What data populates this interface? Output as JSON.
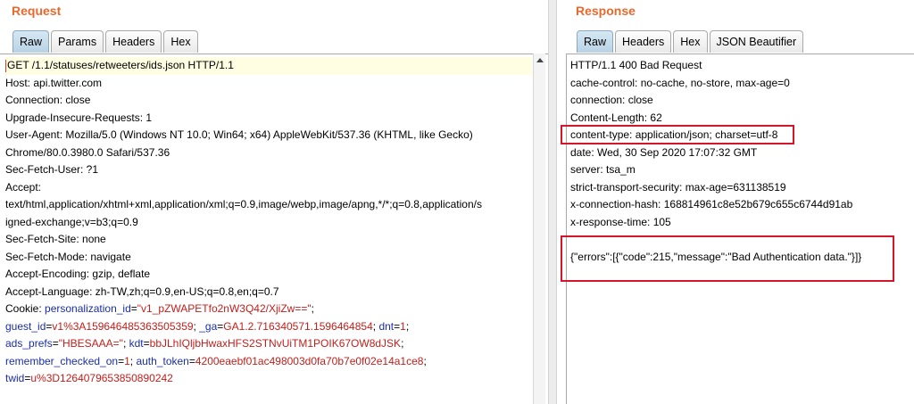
{
  "request": {
    "title": "Request",
    "tabs": [
      "Raw",
      "Params",
      "Headers",
      "Hex"
    ],
    "active_tab": 0,
    "lines": [
      [
        {
          "t": "GET /1.1/statuses/retweeters/ids.json HTTP/1.1"
        }
      ],
      [
        {
          "t": "Host: api.twitter.com"
        }
      ],
      [
        {
          "t": "Connection: close"
        }
      ],
      [
        {
          "t": "Upgrade-Insecure-Requests: 1"
        }
      ],
      [
        {
          "t": "User-Agent: Mozilla/5.0 (Windows NT 10.0; Win64; x64) AppleWebKit/537.36 (KHTML, like Gecko)"
        }
      ],
      [
        {
          "t": "Chrome/80.0.3980.0 Safari/537.36"
        }
      ],
      [
        {
          "t": "Sec-Fetch-User: ?1"
        }
      ],
      [
        {
          "t": "Accept:"
        }
      ],
      [
        {
          "t": "text/html,application/xhtml+xml,application/xml;q=0.9,image/webp,image/apng,*/*;q=0.8,application/s"
        }
      ],
      [
        {
          "t": "igned-exchange;v=b3;q=0.9"
        }
      ],
      [
        {
          "t": "Sec-Fetch-Site: none"
        }
      ],
      [
        {
          "t": "Sec-Fetch-Mode: navigate"
        }
      ],
      [
        {
          "t": "Accept-Encoding: gzip, deflate"
        }
      ],
      [
        {
          "t": "Accept-Language: zh-TW,zh;q=0.9,en-US;q=0.8,en;q=0.7"
        }
      ],
      [
        {
          "t": "Cookie: "
        },
        {
          "t": "personalization_id",
          "c": "k"
        },
        {
          "t": "="
        },
        {
          "t": "\"v1_pZWAPETfo2nW3Q42/XjiZw==\"",
          "c": "v"
        },
        {
          "t": ";"
        }
      ],
      [
        {
          "t": "guest_id",
          "c": "k"
        },
        {
          "t": "="
        },
        {
          "t": "v1%3A159646485363505359",
          "c": "v"
        },
        {
          "t": "; "
        },
        {
          "t": "_ga",
          "c": "k"
        },
        {
          "t": "="
        },
        {
          "t": "GA1.2.716340571.1596464854",
          "c": "v"
        },
        {
          "t": "; "
        },
        {
          "t": "dnt",
          "c": "k"
        },
        {
          "t": "="
        },
        {
          "t": "1",
          "c": "v"
        },
        {
          "t": ";"
        }
      ],
      [
        {
          "t": "ads_prefs",
          "c": "k"
        },
        {
          "t": "="
        },
        {
          "t": "\"HBESAAA=\"",
          "c": "v"
        },
        {
          "t": "; "
        },
        {
          "t": "kdt",
          "c": "k"
        },
        {
          "t": "="
        },
        {
          "t": "bbJLhIQljbHwaxHFS2STNvUiTM1POIK67OW8dJSK",
          "c": "v"
        },
        {
          "t": ";"
        }
      ],
      [
        {
          "t": "remember_checked_on",
          "c": "k"
        },
        {
          "t": "="
        },
        {
          "t": "1",
          "c": "v"
        },
        {
          "t": "; "
        },
        {
          "t": "auth_token",
          "c": "k"
        },
        {
          "t": "="
        },
        {
          "t": "4200eaebf01ac498003d0fa70b7e0f02e14a1ce8",
          "c": "v"
        },
        {
          "t": ";"
        }
      ],
      [
        {
          "t": "twid",
          "c": "k"
        },
        {
          "t": "="
        },
        {
          "t": "u%3D1264079653850890242",
          "c": "v"
        }
      ]
    ]
  },
  "response": {
    "title": "Response",
    "tabs": [
      "Raw",
      "Headers",
      "Hex",
      "JSON Beautifier"
    ],
    "active_tab": 0,
    "lines": [
      [
        {
          "t": "HTTP/1.1 400 Bad Request"
        }
      ],
      [
        {
          "t": "cache-control: no-cache, no-store, max-age=0"
        }
      ],
      [
        {
          "t": "connection: close"
        }
      ],
      [
        {
          "t": "Content-Length: 62"
        }
      ],
      [
        {
          "t": "content-type: application/json; charset=utf-8"
        }
      ],
      [
        {
          "t": "date: Wed, 30 Sep 2020 17:07:32 GMT"
        }
      ],
      [
        {
          "t": "server: tsa_m"
        }
      ],
      [
        {
          "t": "strict-transport-security: max-age=631138519"
        }
      ],
      [
        {
          "t": "x-connection-hash: 168814961c8e52b679c655c6744d91ab"
        }
      ],
      [
        {
          "t": "x-response-time: 105"
        }
      ],
      [
        {
          "t": ""
        }
      ],
      [
        {
          "t": "{\"errors\":[{\"code\":215,\"message\":\"Bad Authentication data.\"}]}"
        }
      ]
    ]
  },
  "colors": {
    "title": "#e8692e",
    "highlight_box": "#d4152c",
    "cookie_key": "#1a2ea8",
    "cookie_value": "#c0201c"
  }
}
